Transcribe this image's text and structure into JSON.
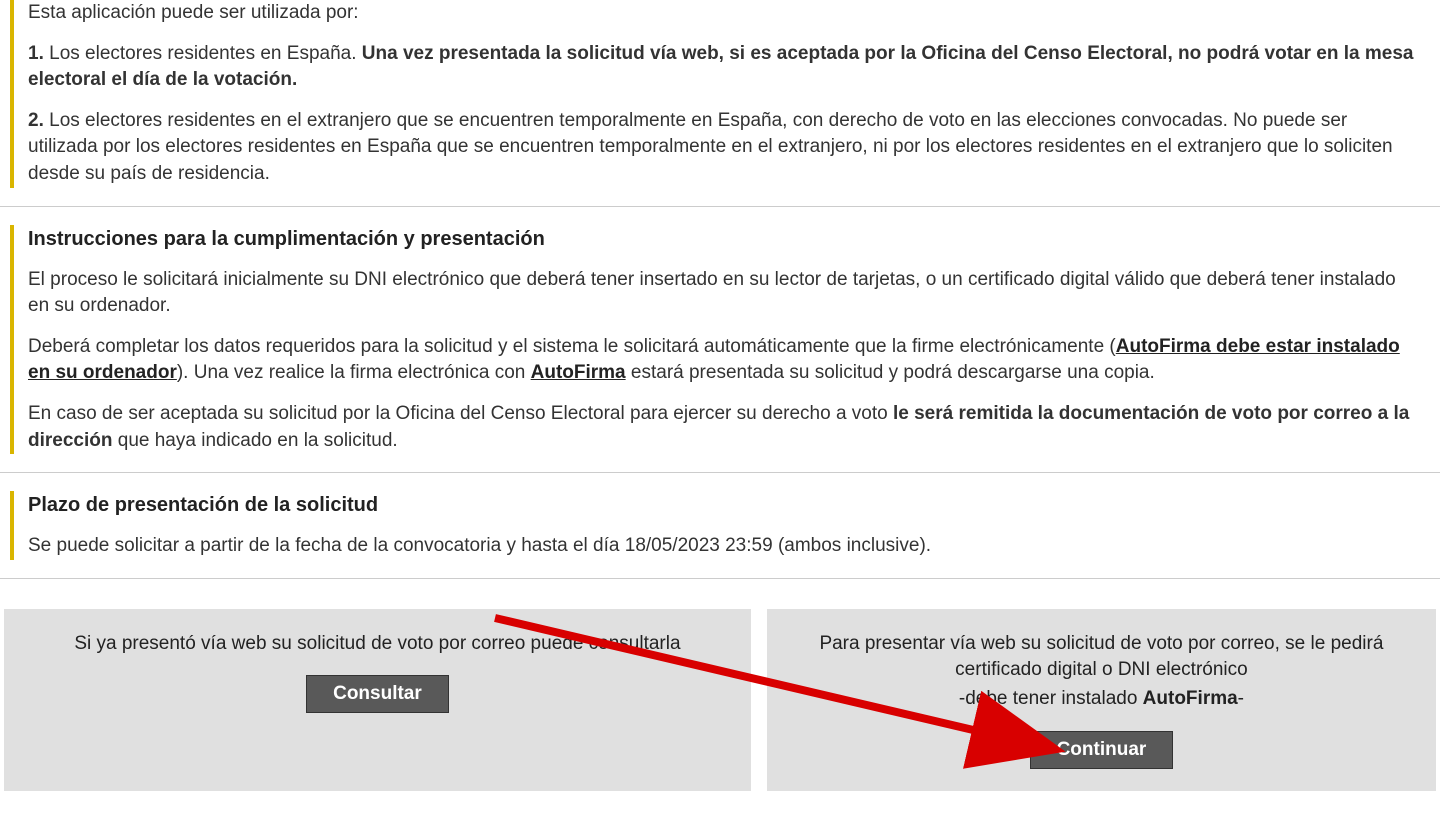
{
  "section_intro": {
    "intro": "Esta aplicación puede ser utilizada por:",
    "item1_prefix": "1.",
    "item1_plain": " Los electores residentes en España. ",
    "item1_bold": "Una vez presentada la solicitud vía web, si es aceptada por la Oficina del Censo Electoral, no podrá votar en la mesa electoral el día de la votación.",
    "item2_prefix": "2.",
    "item2_text": " Los electores residentes en el extranjero que se encuentren temporalmente en España, con derecho de voto en las elecciones convocadas. No puede ser utilizada por los electores residentes en España que se encuentren temporalmente en el extranjero, ni por los electores residentes en el extranjero que lo soliciten desde su país de residencia."
  },
  "section_instr": {
    "title": "Instrucciones para la cumplimentación y presentación",
    "p1": "El proceso le solicitará inicialmente su DNI electrónico que deberá tener insertado en su lector de tarjetas, o un certificado digital válido que deberá tener instalado en su ordenador.",
    "p2_a": "Deberá completar los datos requeridos para la solicitud y el sistema le solicitará automáticamente que la firme electrónicamente (",
    "p2_autofirma_bold": "AutoFirma debe estar instalado en su ordenador",
    "p2_b": "). Una vez realice la firma electrónica con ",
    "p2_autofirma_link": "AutoFirma",
    "p2_c": " estará presentada su solicitud y podrá descargarse una copia.",
    "p3_a": "En caso de ser aceptada su solicitud por la Oficina del Censo Electoral para ejercer su derecho a voto ",
    "p3_bold": "le será remitida la documentación de voto por correo a la dirección",
    "p3_b": " que haya indicado en la solicitud."
  },
  "section_deadline": {
    "title": "Plazo de presentación de la solicitud",
    "text": "Se puede solicitar a partir de la fecha de la convocatoria y hasta el día 18/05/2023 23:59 (ambos inclusive)."
  },
  "actions": {
    "left_text": "Si ya presentó vía web su solicitud de voto por correo puede consultarla",
    "left_btn": "Consultar",
    "right_line1": "Para presentar vía web su solicitud de voto por correo, se le pedirá certificado digital o DNI electrónico",
    "right_line2_a": "-debe tener instalado ",
    "right_line2_bold": "AutoFirma",
    "right_line2_b": "-",
    "right_btn": "Continuar"
  }
}
